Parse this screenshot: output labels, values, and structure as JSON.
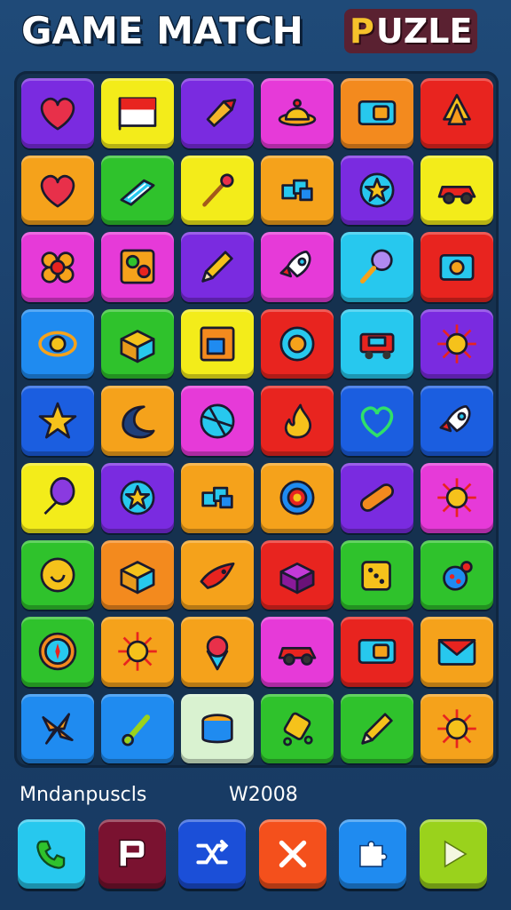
{
  "header": {
    "title_main": "GAME MATCH",
    "title_accent_first": "P",
    "title_accent_rest": "UZLE"
  },
  "board": {
    "columns": 6,
    "rows": 9,
    "tiles": [
      {
        "color": "#7a2be0",
        "icon": "heart-icon"
      },
      {
        "color": "#f3ec1a",
        "icon": "flag-icon"
      },
      {
        "color": "#7a2be0",
        "icon": "cone-icon"
      },
      {
        "color": "#e63ad8",
        "icon": "bell-hat-icon"
      },
      {
        "color": "#f38a1e",
        "icon": "ticket-icon"
      },
      {
        "color": "#e8241f",
        "icon": "tree-icon"
      },
      {
        "color": "#f5a21b",
        "icon": "heart-icon"
      },
      {
        "color": "#2fc22c",
        "icon": "book-icon"
      },
      {
        "color": "#f3ec1a",
        "icon": "wand-icon"
      },
      {
        "color": "#f5a21b",
        "icon": "cubes-icon"
      },
      {
        "color": "#7a2be0",
        "icon": "star-badge-icon"
      },
      {
        "color": "#f3ec1a",
        "icon": "car-icon"
      },
      {
        "color": "#e63ad8",
        "icon": "flower-icon"
      },
      {
        "color": "#e63ad8",
        "icon": "puzzle-icon"
      },
      {
        "color": "#7a2be0",
        "icon": "pencil-icon"
      },
      {
        "color": "#e63ad8",
        "icon": "rocket-icon"
      },
      {
        "color": "#27c8ee",
        "icon": "magnifier-icon"
      },
      {
        "color": "#e8241f",
        "icon": "camera-icon"
      },
      {
        "color": "#1f8bf0",
        "icon": "orbit-icon"
      },
      {
        "color": "#2fc22c",
        "icon": "box-icon"
      },
      {
        "color": "#f3ec1a",
        "icon": "picture-icon"
      },
      {
        "color": "#e8241f",
        "icon": "ring-icon"
      },
      {
        "color": "#27c8ee",
        "icon": "truck-icon"
      },
      {
        "color": "#7a2be0",
        "icon": "sun-icon"
      },
      {
        "color": "#1b5ee0",
        "icon": "star-icon"
      },
      {
        "color": "#f5a21b",
        "icon": "crescent-icon"
      },
      {
        "color": "#e63ad8",
        "icon": "ball-icon"
      },
      {
        "color": "#e8241f",
        "icon": "flame-icon"
      },
      {
        "color": "#1b5ee0",
        "icon": "heart-outline-icon"
      },
      {
        "color": "#1b5ee0",
        "icon": "rocket-icon"
      },
      {
        "color": "#f3ec1a",
        "icon": "balloon-icon"
      },
      {
        "color": "#7a2be0",
        "icon": "star-badge-icon"
      },
      {
        "color": "#f5a21b",
        "icon": "cubes-icon"
      },
      {
        "color": "#f5a21b",
        "icon": "gear-icon"
      },
      {
        "color": "#7a2be0",
        "icon": "bandage-icon"
      },
      {
        "color": "#e63ad8",
        "icon": "sun-icon"
      },
      {
        "color": "#2fc22c",
        "icon": "coin-icon"
      },
      {
        "color": "#f38a1e",
        "icon": "box-icon"
      },
      {
        "color": "#f5a21b",
        "icon": "fish-icon"
      },
      {
        "color": "#e8241f",
        "icon": "gift-box-icon"
      },
      {
        "color": "#2fc22c",
        "icon": "dice-icon"
      },
      {
        "color": "#2fc22c",
        "icon": "ladybug-icon"
      },
      {
        "color": "#2fc22c",
        "icon": "compass-icon"
      },
      {
        "color": "#f5a21b",
        "icon": "sun-icon"
      },
      {
        "color": "#f5a21b",
        "icon": "ice-cream-icon"
      },
      {
        "color": "#e63ad8",
        "icon": "car-icon"
      },
      {
        "color": "#e8241f",
        "icon": "ticket-icon"
      },
      {
        "color": "#f5a21b",
        "icon": "envelope-icon"
      },
      {
        "color": "#1f8bf0",
        "icon": "pinwheel-icon"
      },
      {
        "color": "#1f8bf0",
        "icon": "key-icon"
      },
      {
        "color": "#d9f2d0",
        "icon": "drum-icon"
      },
      {
        "color": "#2fc22c",
        "icon": "lantern-icon"
      },
      {
        "color": "#2fc22c",
        "icon": "pencil-icon"
      },
      {
        "color": "#f5a21b",
        "icon": "sun-icon"
      }
    ]
  },
  "footer": {
    "left_text": "Mndanpuscls",
    "right_text": "W2008"
  },
  "controls": [
    {
      "color": "#27c8ee",
      "icon": "phone-icon",
      "name": "phone-button"
    },
    {
      "color": "#7a1230",
      "icon": "page-icon",
      "name": "page-button"
    },
    {
      "color": "#1b4fd8",
      "icon": "shuffle-icon",
      "name": "shuffle-button"
    },
    {
      "color": "#f4501c",
      "icon": "close-icon",
      "name": "close-button"
    },
    {
      "color": "#1f8bf0",
      "icon": "puzzle-piece-icon",
      "name": "puzzle-button"
    },
    {
      "color": "#9ad21c",
      "icon": "play-icon",
      "name": "play-button"
    }
  ]
}
